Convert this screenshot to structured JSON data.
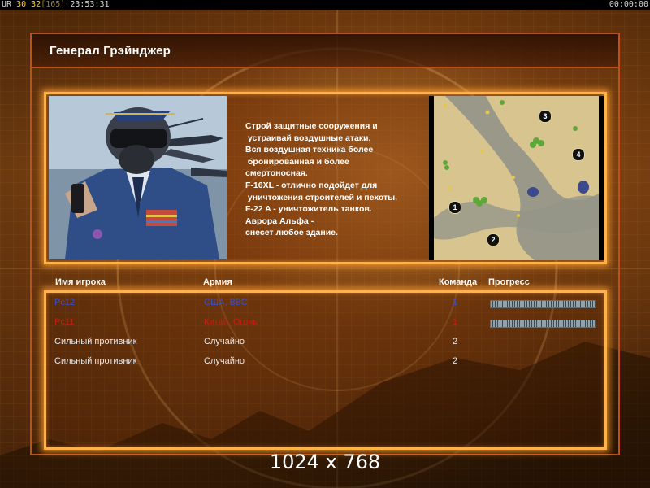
{
  "status_bar": {
    "prefix": "UR",
    "fps_a": "30",
    "fps_b": "32",
    "frame": "[165]",
    "clock": "23:53:31",
    "timer": "00:00:00"
  },
  "briefing": {
    "title": "Генерал Грэйнджер",
    "description_lines": [
      "Строй защитные сооружения и",
      " устраивай воздушные атаки.",
      "Вся воздушная техника более",
      " бронированная и более",
      "смертоносная.",
      "F-16XL - отлично подойдет для",
      " уничтожения строителей и пехоты.",
      "F-22 A - уничтожитель танков.",
      "Аврора Альфа -",
      "снесет любое здание."
    ],
    "map_start_positions": [
      "1",
      "2",
      "3",
      "4"
    ]
  },
  "players": {
    "headers": {
      "name": "Имя игрока",
      "army": "Армия",
      "team": "Команда",
      "progress": "Прогресс"
    },
    "rows": [
      {
        "name": "Pc12",
        "army": "США, ВВС",
        "team": "1",
        "progress": 1.0,
        "color": "#3a4fc8"
      },
      {
        "name": "Pc11",
        "army": "Китай, Огонь",
        "team": "1",
        "progress": 1.0,
        "color": "#c81e14"
      },
      {
        "name": "Сильный противник",
        "army": "Случайно",
        "team": "2",
        "progress": null,
        "color": "#e8e8e8"
      },
      {
        "name": "Сильный противник",
        "army": "Случайно",
        "team": "2",
        "progress": null,
        "color": "#e8e8e8"
      }
    ]
  },
  "resolution_label": "1024 x 768",
  "colors": {
    "panel_border": "#ffb24a",
    "frame_line": "#c0501a"
  }
}
